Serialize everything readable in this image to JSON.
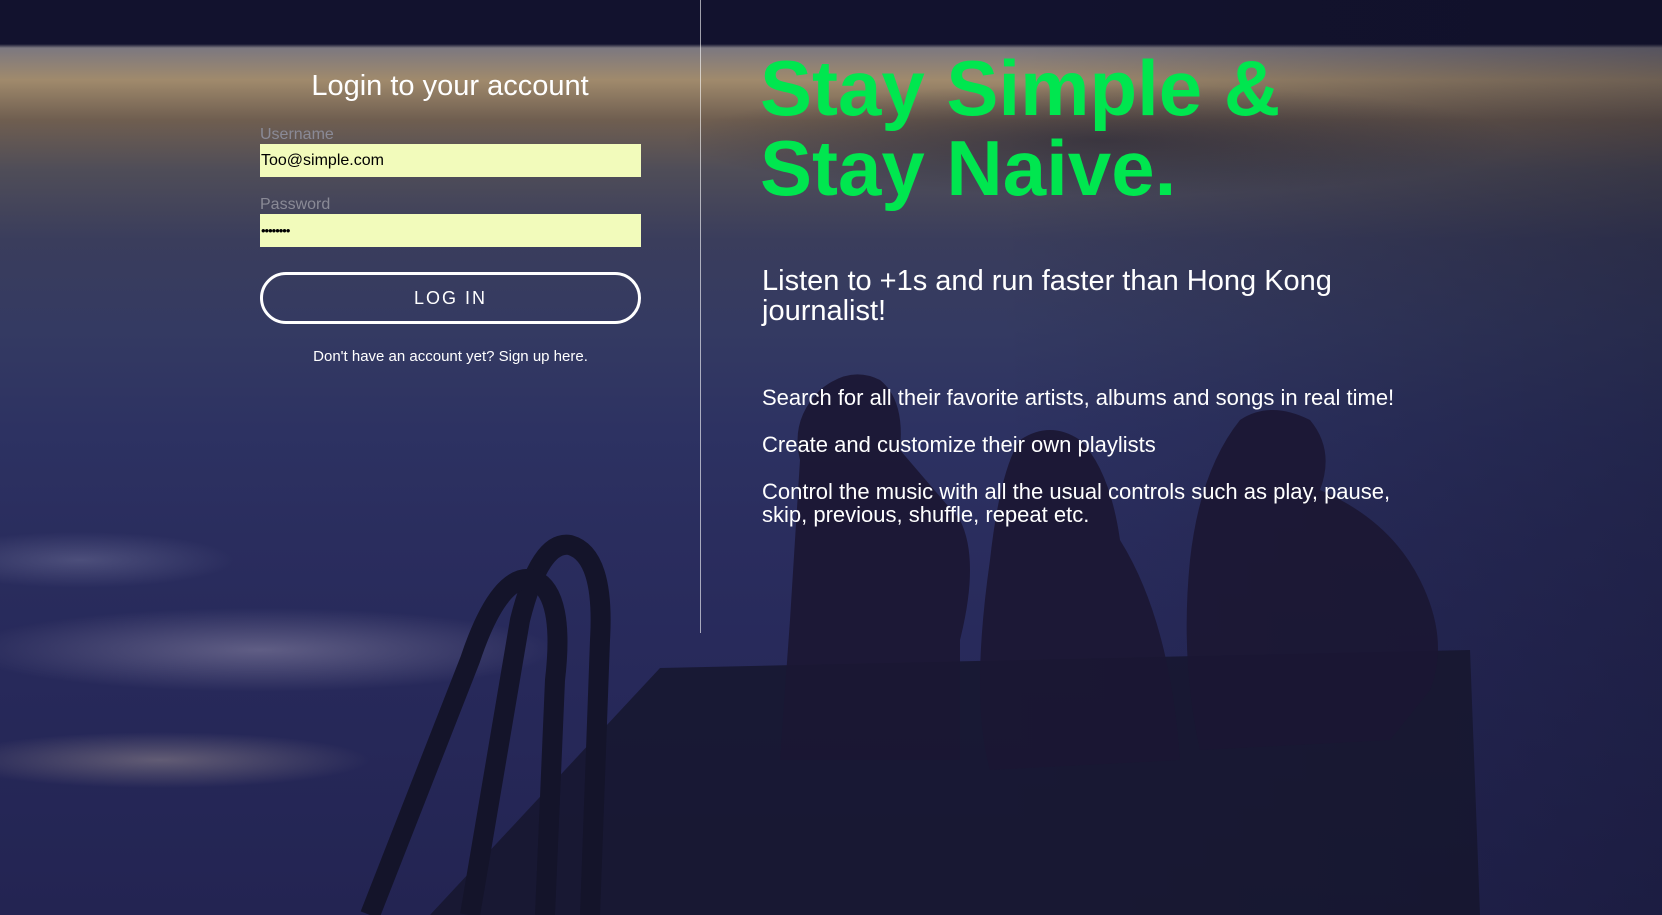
{
  "login": {
    "title": "Login to your account",
    "username_label": "Username",
    "username_value": "Too@simple.com",
    "password_label": "Password",
    "password_value": "••••••••",
    "button_label": "LOG IN",
    "signup_text": "Don't have an account yet? Sign up here."
  },
  "promo": {
    "headline_line1": "Stay Simple &",
    "headline_line2": "Stay Naive.",
    "subheadline": "Listen to +1s and run faster than Hong Kong journalist!",
    "features": [
      "Search for all their favorite artists, albums and songs in real time!",
      "Create and customize their own playlists",
      "Control the music with all the usual controls such as play, pause, skip, previous, shuffle, repeat etc."
    ]
  },
  "colors": {
    "accent_green": "#00e64f",
    "input_background": "#f2fbbb"
  }
}
